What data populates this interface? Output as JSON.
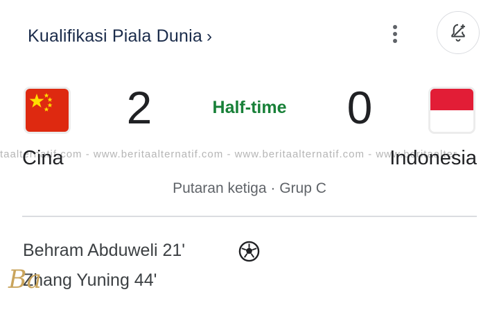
{
  "header": {
    "title": "Kualifikasi Piala Dunia",
    "chevron": "›",
    "more_icon": "more-vert-icon",
    "notify_icon": "bell-add-icon"
  },
  "match": {
    "status": "Half-time",
    "round": "Putaran ketiga · Grup C",
    "home": {
      "name": "Cina",
      "score": "2",
      "flag": "china-flag"
    },
    "away": {
      "name": "Indonesia",
      "score": "0",
      "flag": "indonesia-flag"
    },
    "scorers": [
      {
        "text": "Behram Abduweli 21'"
      },
      {
        "text": "Zhang Yuning 44'"
      }
    ],
    "goal_icon": "soccer-ball-icon"
  },
  "watermark": "taalternatif.com - www.beritaalternatif.com - www.beritaalternatif.com - www.beritaalter",
  "colors": {
    "status_green": "#188038",
    "title_blue": "#1a2b4a",
    "china_red": "#de2910",
    "indonesia_red": "#e21d36"
  }
}
